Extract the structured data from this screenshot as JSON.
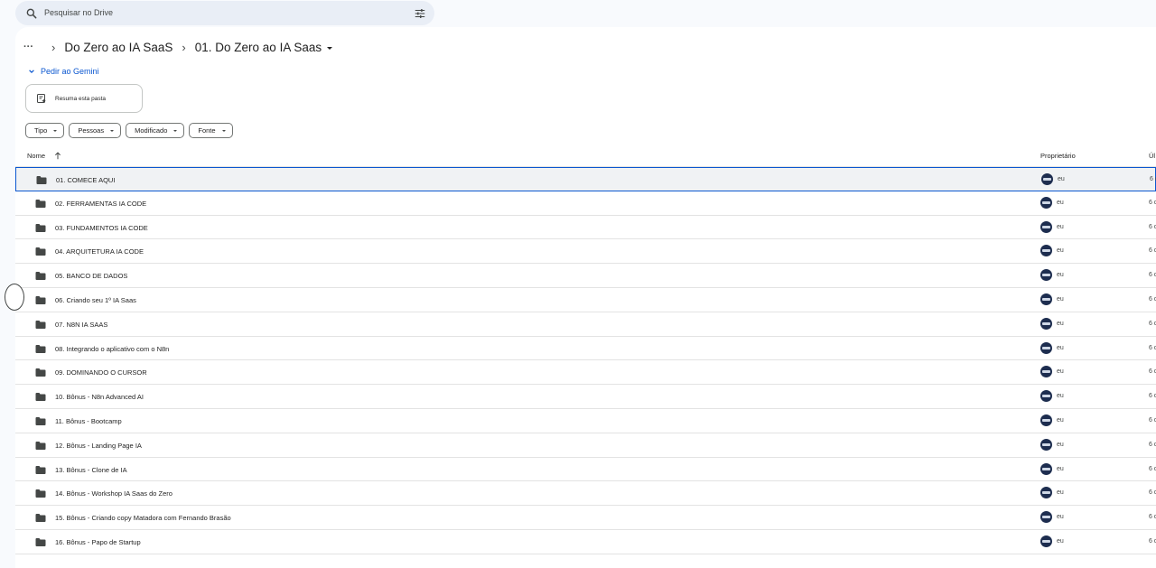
{
  "search": {
    "placeholder": "Pesquisar no Drive"
  },
  "breadcrumb": {
    "more": "···",
    "items": [
      "Do Zero ao IA SaaS",
      "01. Do Zero ao IA Saas"
    ]
  },
  "gemini": {
    "label": "Pedir ao Gemini"
  },
  "summary": {
    "label": "Resuma esta pasta"
  },
  "filters": [
    "Tipo",
    "Pessoas",
    "Modificado",
    "Fonte"
  ],
  "table": {
    "headers": {
      "name": "Nome",
      "owner": "Proprietário",
      "last": "Úl"
    },
    "rows": [
      {
        "name": "01. COMECE AQUI",
        "owner": "eu",
        "last": "6 d"
      },
      {
        "name": "02. FERRAMENTAS IA CODE",
        "owner": "eu",
        "last": "6 d"
      },
      {
        "name": "03. FUNDAMENTOS IA CODE",
        "owner": "eu",
        "last": "6 d"
      },
      {
        "name": "04. ARQUITETURA IA CODE",
        "owner": "eu",
        "last": "6 d"
      },
      {
        "name": "05. BANCO DE DADOS",
        "owner": "eu",
        "last": "6 d"
      },
      {
        "name": "06. Criando seu 1º IA Saas",
        "owner": "eu",
        "last": "6 d"
      },
      {
        "name": "07. N8N IA SAAS",
        "owner": "eu",
        "last": "6 d"
      },
      {
        "name": "08. Integrando o aplicativo com o N8n",
        "owner": "eu",
        "last": "6 d"
      },
      {
        "name": "09. DOMINANDO O CURSOR",
        "owner": "eu",
        "last": "6 d"
      },
      {
        "name": "10. Bônus - N8n Advanced AI",
        "owner": "eu",
        "last": "6 d"
      },
      {
        "name": "11. Bônus - Bootcamp",
        "owner": "eu",
        "last": "6 d"
      },
      {
        "name": "12. Bônus - Landing Page IA",
        "owner": "eu",
        "last": "6 d"
      },
      {
        "name": "13. Bônus - Clone de IA",
        "owner": "eu",
        "last": "6 d"
      },
      {
        "name": "14. Bônus - Workshop IA Saas do Zero",
        "owner": "eu",
        "last": "6 d"
      },
      {
        "name": "15. Bônus - Criando copy Matadora com Fernando Brasão",
        "owner": "eu",
        "last": "6 d"
      },
      {
        "name": "16. Bônus - Papo de Startup",
        "owner": "eu",
        "last": "6 d"
      }
    ]
  },
  "colors": {
    "accent": "#0b57d0",
    "folder": "#444746",
    "avatar": "#1d2d4f"
  },
  "icons": [
    "search-icon",
    "tune-icon",
    "chevron-down-icon",
    "summary-icon",
    "folder-icon",
    "arrow-up-icon"
  ]
}
